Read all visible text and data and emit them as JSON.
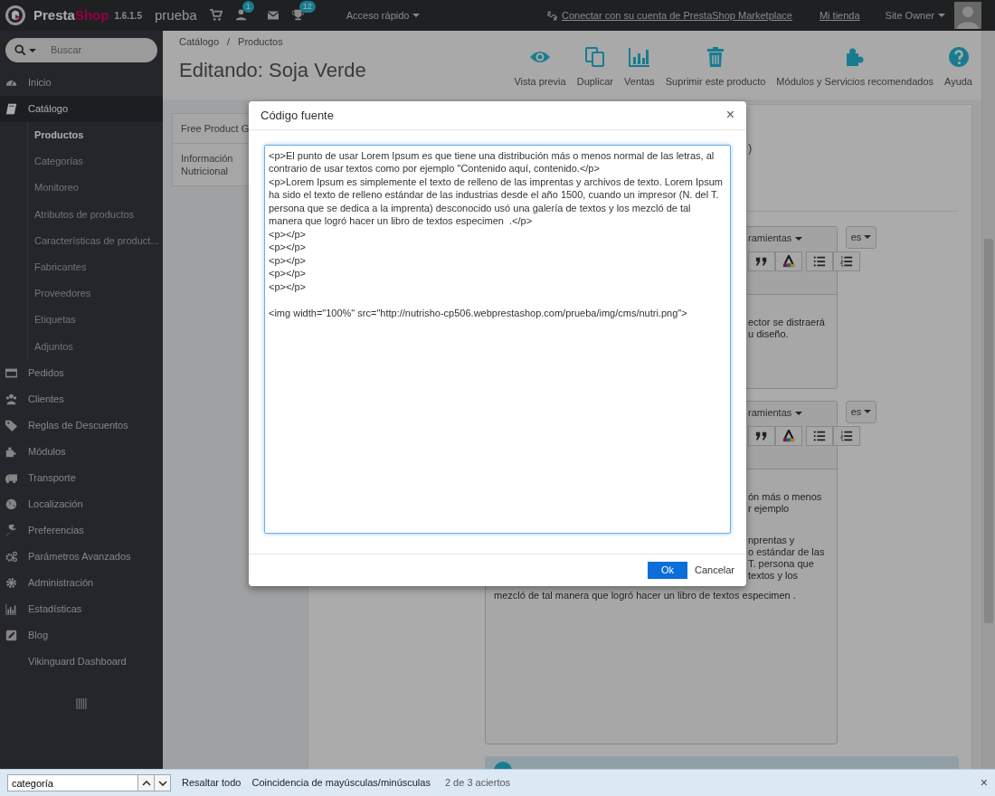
{
  "topbar": {
    "brand_first": "Presta",
    "brand_second": "Shop",
    "version": "1.6.1.5",
    "shop": "prueba",
    "customer_badge": "1",
    "trophy_badge": "12",
    "quick_access": "Acceso rápido",
    "marketplace": "Conectar con su cuenta de PrestaShop Marketplace",
    "my_shop": "Mi tienda",
    "user": "Site Owner"
  },
  "sidebar": {
    "search_placeholder": "Buscar",
    "items": [
      {
        "label": "Inicio",
        "selected": false
      },
      {
        "label": "Catálogo",
        "selected": true,
        "children": [
          {
            "label": "Productos",
            "selected": true
          },
          {
            "label": "Categorías",
            "selected": false
          },
          {
            "label": "Monitoreo",
            "selected": false
          },
          {
            "label": "Atributos de productos",
            "selected": false
          },
          {
            "label": "Características de product...",
            "selected": false
          },
          {
            "label": "Fabricantes",
            "selected": false
          },
          {
            "label": "Proveedores",
            "selected": false
          },
          {
            "label": "Etiquetas",
            "selected": false
          },
          {
            "label": "Adjuntos",
            "selected": false
          }
        ]
      },
      {
        "label": "Pedidos",
        "selected": false
      },
      {
        "label": "Clientes",
        "selected": false
      },
      {
        "label": "Reglas de Descuentos",
        "selected": false
      },
      {
        "label": "Módulos",
        "selected": false
      },
      {
        "label": "Transporte",
        "selected": false
      },
      {
        "label": "Localización",
        "selected": false
      },
      {
        "label": "Preferencias",
        "selected": false
      },
      {
        "label": "Parámetros Avanzados",
        "selected": false
      },
      {
        "label": "Administración",
        "selected": false
      },
      {
        "label": "Estadísticas",
        "selected": false
      },
      {
        "label": "Blog",
        "selected": false
      },
      {
        "label": "Vikinguard Dashboard",
        "selected": false
      }
    ]
  },
  "header": {
    "breadcrumb": [
      "Catálogo",
      "Productos"
    ],
    "breadcrumb_separator": "/",
    "title": "Editando: Soja Verde",
    "actions": [
      "Vista previa",
      "Duplicar",
      "Ventas",
      "Suprimir este producto",
      "Módulos y Servicios recomendados",
      "Ayuda"
    ]
  },
  "product_tabs": [
    "Free Product G",
    "Información Nutricional"
  ],
  "form": {
    "fragment": ")",
    "editors": [
      {
        "tools_label": "ramientas",
        "language": "es",
        "paragraphs": [
          [
            "ector se distraerá",
            "u diseño."
          ]
        ]
      },
      {
        "tools_label": "ramientas",
        "language": "es",
        "paragraphs": [
          [
            "ón más o menos",
            "r ejemplo"
          ],
          [
            "nprentas y",
            "o estándar de las",
            "T. persona que",
            "textos y los"
          ]
        ],
        "full_line": "mezcló de tal manera que logró hacer un libro de textos especimen  ."
      }
    ]
  },
  "modal": {
    "title": "Código fuente",
    "close": "×",
    "source": "<p>El punto de usar Lorem Ipsum es que tiene una distribución más o menos normal de las letras, al contrario de usar textos como por ejemplo \"Contenido aquí, contenido.</p>\n<p>Lorem Ipsum es simplemente el texto de relleno de las imprentas y archivos de texto. Lorem Ipsum ha sido el texto de relleno estándar de las industrias desde el año 1500, cuando un impresor (N. del T. persona que se dedica a la imprenta) desconocido usó una galería de textos y los mezcló de tal manera que logró hacer un libro de textos especimen  .</p>\n<p></p>\n<p></p>\n<p></p>\n<p></p>\n<p></p>\n\n<img width=\"100%\" src=\"http://nutrisho-cp506.webprestashop.com/prueba/img/cms/nutri.png\">",
    "ok": "Ok",
    "cancel": "Cancelar"
  },
  "find_bar": {
    "value": "categoría",
    "highlight_all": "Resaltar todo",
    "match_case": "Coincidencia de mayúsculas/minúsculas",
    "result": "2 de 3 aciertos",
    "close": "×"
  }
}
